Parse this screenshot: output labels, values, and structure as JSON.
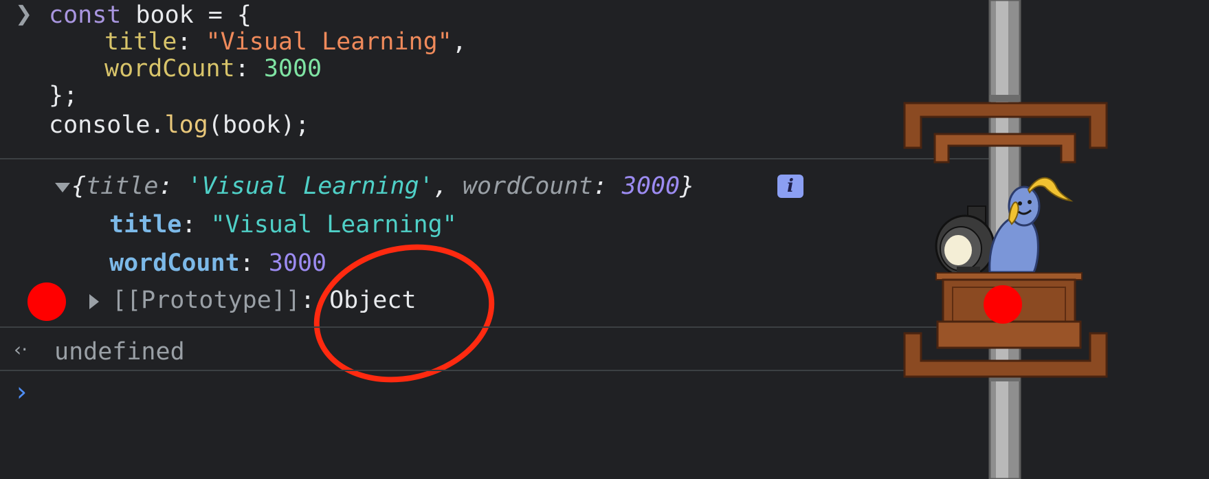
{
  "console": {
    "code": {
      "line1": {
        "kw": "const",
        "rest": " book = {"
      },
      "line2": {
        "key": "title",
        "colon": ": ",
        "value": "\"Visual Learning\"",
        "comma": ","
      },
      "line3": {
        "key": "wordCount",
        "colon": ": ",
        "value": "3000"
      },
      "line4": "};",
      "line5": {
        "obj": "console.",
        "method": "log",
        "args": "(book);"
      }
    },
    "output": {
      "summary": {
        "open_brace": "{",
        "title_key": "title",
        "colon1": ": ",
        "title_value": "'Visual Learning'",
        "sep": ", ",
        "wc_key": "wordCount",
        "colon2": ": ",
        "wc_value": "3000",
        "close_brace": "}",
        "info_glyph": "i"
      },
      "properties": [
        {
          "key": "title",
          "colon": ": ",
          "value": "\"Visual Learning\""
        },
        {
          "key": "wordCount",
          "colon": ": ",
          "value": "3000"
        }
      ],
      "prototype": {
        "label": "[[Prototype]]",
        "colon": ": ",
        "value": "Object"
      }
    },
    "result": {
      "glyph": "‹·",
      "value": "undefined"
    },
    "prompt_glyph": "›"
  },
  "colors": {
    "background": "#202124",
    "annotation_red": "#ff0000",
    "elevator_wood": "#8b4a22",
    "elevator_pole": "#a8a8a8"
  },
  "icons": {
    "input_prompt": "chevron-right-icon",
    "expand_open": "triangle-down-icon",
    "expand_closed": "triangle-right-icon",
    "info": "info-icon",
    "return_value": "return-arrow-icon",
    "character": "genie-elevator-illustration"
  }
}
